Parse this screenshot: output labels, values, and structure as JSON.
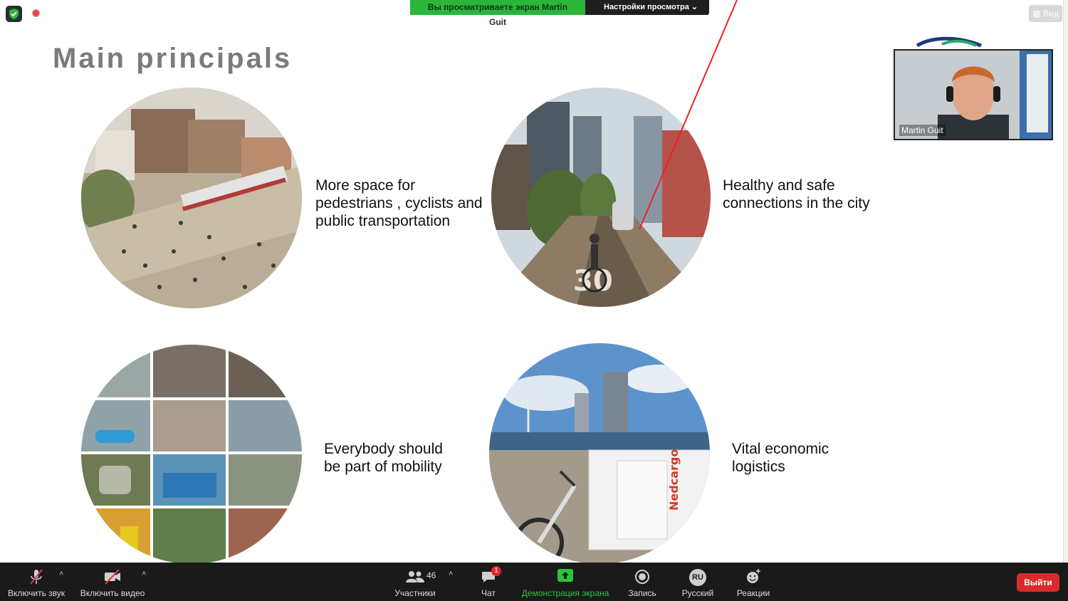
{
  "topbar": {
    "share_notice": "Вы просматриваете экран Martin Guit",
    "view_options": "Настройки просмотра",
    "view_button": "Вид"
  },
  "slide": {
    "title": "Main principals",
    "items": [
      {
        "lines": [
          "More space for",
          "pedestrians , cyclists and",
          "public transportation"
        ]
      },
      {
        "lines": [
          "Healthy and safe",
          "connections in the city"
        ]
      },
      {
        "lines": [
          "Everybody should",
          "be part of mobility"
        ]
      },
      {
        "lines": [
          "Vital economic",
          "logistics"
        ]
      }
    ]
  },
  "video": {
    "participant_name": "Martin Guit"
  },
  "toolbar": {
    "unmute": "Включить звук",
    "start_video": "Включить видео",
    "participants": "Участники",
    "participants_count": "46",
    "chat": "Чат",
    "chat_badge": "1",
    "share_screen": "Демонстрация экрана",
    "record": "Запись",
    "language": "Русский",
    "language_code": "RU",
    "reactions": "Реакции",
    "leave": "Выйти"
  },
  "colors": {
    "share_green": "#2bb53a",
    "leave_red": "#d92b2b",
    "toolbar_bg": "#1a1a1a",
    "title_gray": "#7b7b7b"
  }
}
